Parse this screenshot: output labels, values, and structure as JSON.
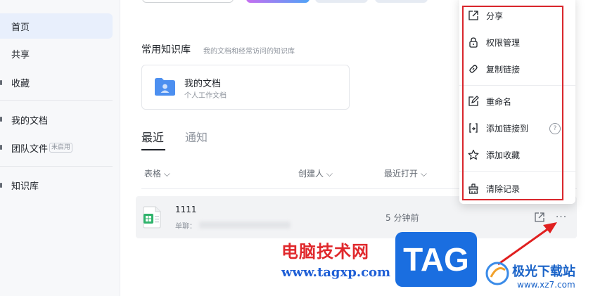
{
  "sidebar": {
    "items": [
      {
        "label": "首页",
        "active": true
      },
      {
        "label": "共享"
      },
      {
        "label": "收藏"
      },
      {
        "label": "我的文档"
      },
      {
        "label": "团队文件",
        "badge": "未启用"
      },
      {
        "label": "知识库"
      }
    ]
  },
  "knowledge": {
    "title": "常用知识库",
    "subtitle": "我的文档和经常访问的知识库",
    "card": {
      "title": "我的文档",
      "subtitle": "个人工作文档"
    }
  },
  "tabs": [
    {
      "label": "最近",
      "active": true
    },
    {
      "label": "通知"
    }
  ],
  "columns": {
    "type": "表格",
    "creator": "创建人",
    "opened": "最近打开"
  },
  "row": {
    "name": "1111",
    "sub": "单聊：",
    "time": "5 分钟前",
    "more": "···"
  },
  "menu": {
    "items": [
      {
        "label": "分享",
        "icon": "share-icon"
      },
      {
        "label": "权限管理",
        "icon": "lock-icon"
      },
      {
        "label": "复制链接",
        "icon": "link-icon"
      },
      {
        "label": "重命名",
        "icon": "edit-icon"
      },
      {
        "label": "添加链接到",
        "icon": "add-link-icon",
        "help": "?"
      },
      {
        "label": "添加收藏",
        "icon": "star-icon"
      },
      {
        "label": "清除记录",
        "icon": "clear-icon"
      }
    ]
  },
  "watermarks": {
    "site_cn": "电脑技术网",
    "site_url": "www.tagxp.com",
    "tag": "TAG",
    "jiguang": "极光下载站",
    "jiguang_url": "www.xz7.com"
  },
  "colors": {
    "accent": "#1a6ee0",
    "highlight_box": "#d9262c",
    "active_nav": "#e8effc"
  }
}
